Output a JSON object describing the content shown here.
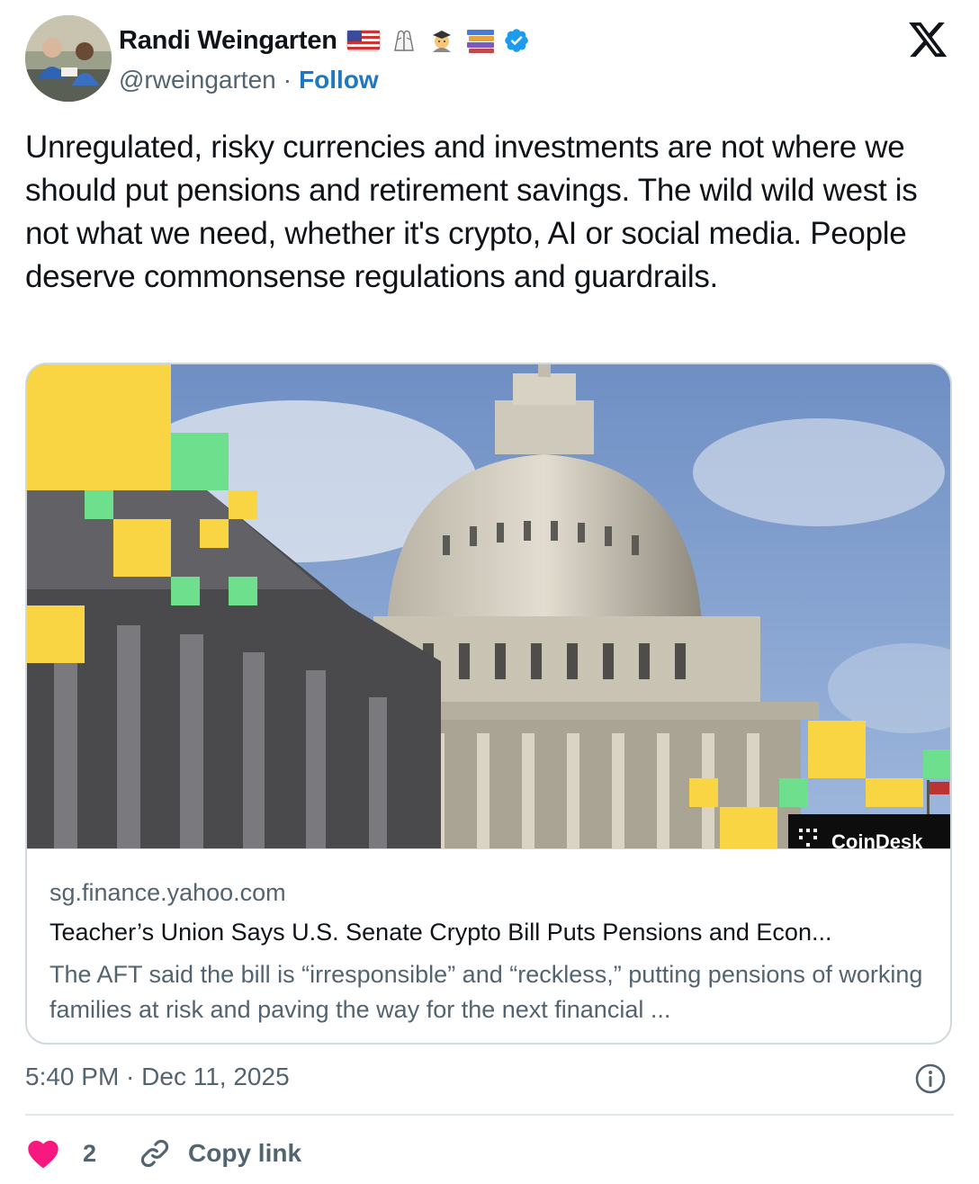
{
  "author": {
    "name": "Randi Weingarten",
    "name_emojis": [
      "us-flag-icon",
      "praying-hands-icon",
      "teacher-icon",
      "books-icon"
    ],
    "handle": "@rweingarten",
    "separator": "·",
    "follow_label": "Follow"
  },
  "tweet": {
    "text": "Unregulated, risky currencies and investments are not where we should put pensions and retirement savings. The wild wild west is not what we need, whether it's crypto, AI or social media. People deserve commonsense regulations and guardrails."
  },
  "link_card": {
    "image_watermark": "CoinDesk",
    "domain": "sg.finance.yahoo.com",
    "title": "Teacher’s Union Says U.S. Senate Crypto Bill Puts Pensions and Econ...",
    "description": "The AFT said the bill is “irresponsible” and “reckless,” putting pensions of working families at risk and paving the way for the next financial ..."
  },
  "meta": {
    "timestamp": "5:40 PM · Dec 11, 2025"
  },
  "actions": {
    "like_count": "2",
    "copy_link_label": "Copy link"
  },
  "colors": {
    "accent": "#1d9bf0",
    "follow": "#1d77c2",
    "heart": "#f91880",
    "muted": "#536471",
    "text": "#0f1419",
    "brand_yellow": "#f9d443",
    "brand_green": "#6ee08d"
  }
}
